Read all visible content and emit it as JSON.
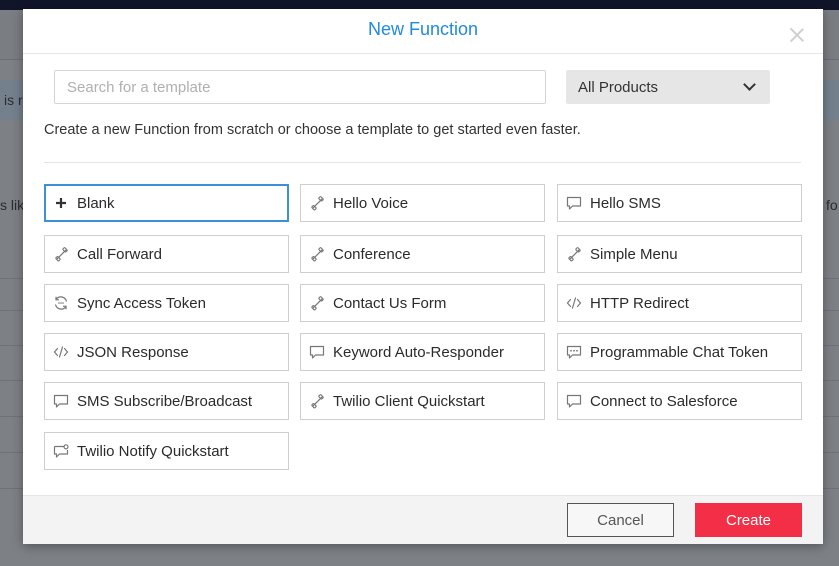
{
  "background": {
    "left_fragment_1": "is r",
    "left_fragment_2": "s lik",
    "right_fragment": "fo"
  },
  "modal": {
    "title": "New Function",
    "search": {
      "placeholder": "Search for a template",
      "value": ""
    },
    "product_filter": {
      "selected": "All Products"
    },
    "description": "Create a new Function from scratch or choose a template to get started even faster.",
    "templates": [
      {
        "label": "Blank",
        "icon": "plus-icon",
        "selected": true
      },
      {
        "label": "Hello Voice",
        "icon": "phone-icon"
      },
      {
        "label": "Hello SMS",
        "icon": "chat-bubble-icon"
      },
      {
        "label": "Call Forward",
        "icon": "phone-icon"
      },
      {
        "label": "Conference",
        "icon": "phone-icon"
      },
      {
        "label": "Simple Menu",
        "icon": "phone-icon"
      },
      {
        "label": "Sync Access Token",
        "icon": "sync-icon"
      },
      {
        "label": "Contact Us Form",
        "icon": "phone-icon"
      },
      {
        "label": "HTTP Redirect",
        "icon": "code-icon"
      },
      {
        "label": "JSON Response",
        "icon": "code-icon"
      },
      {
        "label": "Keyword Auto-Responder",
        "icon": "chat-bubble-icon"
      },
      {
        "label": "Programmable Chat Token",
        "icon": "chat-dots-icon"
      },
      {
        "label": "SMS Subscribe/Broadcast",
        "icon": "chat-bubble-icon"
      },
      {
        "label": "Twilio Client Quickstart",
        "icon": "phone-icon"
      },
      {
        "label": "Connect to Salesforce",
        "icon": "chat-bubble-icon"
      },
      {
        "label": "Twilio Notify Quickstart",
        "icon": "notify-icon"
      }
    ],
    "buttons": {
      "cancel": "Cancel",
      "create": "Create"
    },
    "colors": {
      "title": "#1f8ae0",
      "create_button": "#f22f46",
      "selected_border": "#3d8fd6"
    }
  }
}
